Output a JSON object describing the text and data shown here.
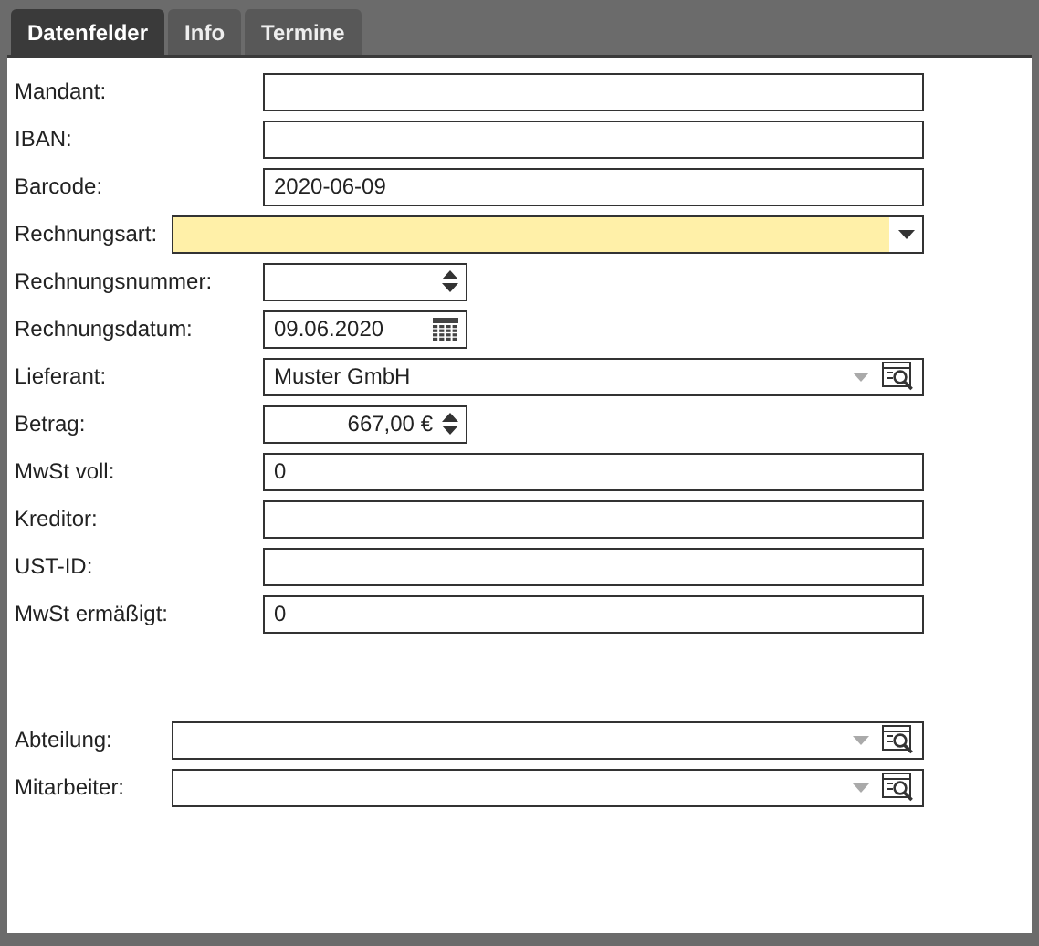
{
  "tabs": [
    {
      "label": "Datenfelder",
      "selected": true
    },
    {
      "label": "Info",
      "selected": false
    },
    {
      "label": "Termine",
      "selected": false
    }
  ],
  "fields": [
    {
      "label": "Mandant:",
      "kind": "text",
      "wide": false,
      "highlighted": false
    },
    {
      "label": "IBAN:",
      "kind": "text",
      "wide": false,
      "highlighted": false
    },
    {
      "label": "Barcode:",
      "kind": "text",
      "value": "2020-06-09",
      "wide": false,
      "highlighted": false
    },
    {
      "label": "Rechnungsart:",
      "kind": "dropdown",
      "wide": true,
      "highlighted": true
    },
    {
      "label": "Rechnungsnummer:",
      "kind": "number",
      "wide": false,
      "highlighted": false
    },
    {
      "label": "Rechnungsdatum:",
      "kind": "date",
      "value": "09.06.2020",
      "wide": false,
      "highlighted": false
    },
    {
      "label": "Lieferant:",
      "kind": "lookup",
      "value": "Muster GmbH",
      "wide": false,
      "highlighted": false
    },
    {
      "label": "Betrag:",
      "kind": "number",
      "value": "667,00 €",
      "wide": false,
      "highlighted": false
    },
    {
      "label": "MwSt voll:",
      "kind": "text",
      "value": "0",
      "wide": false,
      "highlighted": false
    },
    {
      "label": "Kreditor:",
      "kind": "text",
      "wide": false,
      "highlighted": false
    },
    {
      "label": "UST-ID:",
      "kind": "text",
      "wide": false,
      "highlighted": false
    },
    {
      "label": "MwSt ermäßigt:",
      "kind": "text",
      "value": "0",
      "wide": false,
      "highlighted": false
    }
  ],
  "assignment_fields": [
    {
      "label": "Abteilung:",
      "kind": "lookup",
      "wide": true,
      "highlighted": false
    },
    {
      "label": "Mitarbeiter:",
      "kind": "lookup",
      "wide": true,
      "highlighted": false
    }
  ]
}
